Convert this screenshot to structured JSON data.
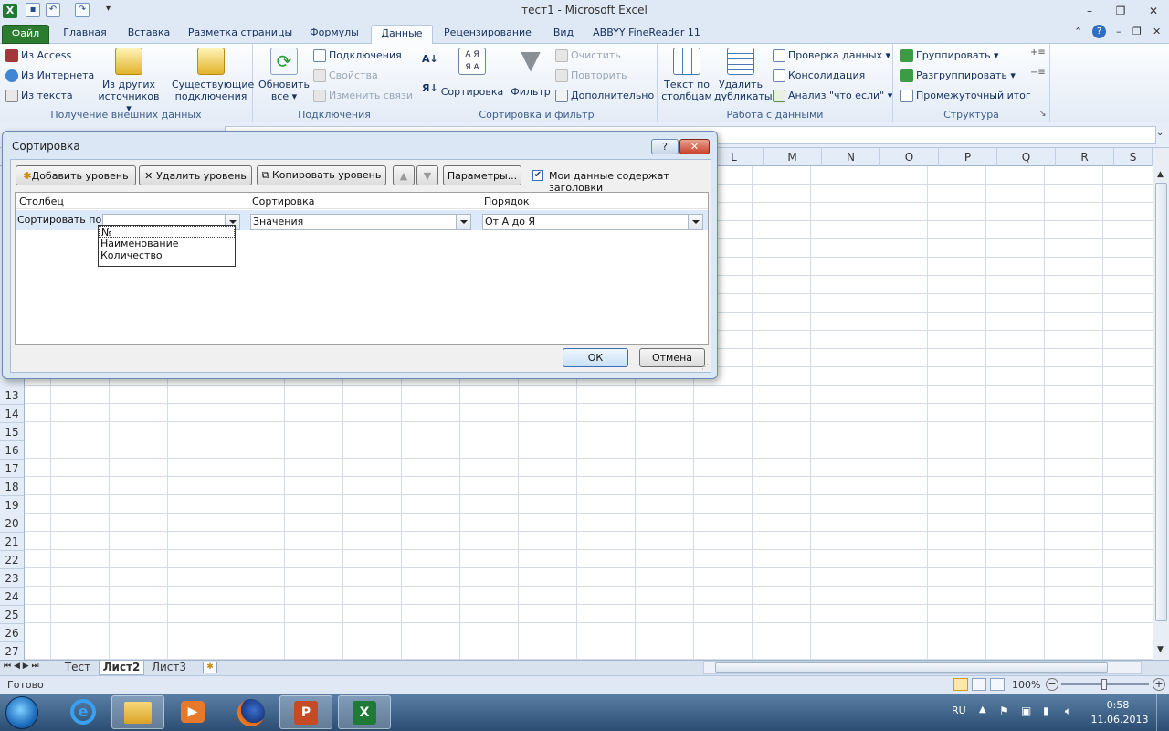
{
  "window": {
    "title": "тест1  -  Microsoft Excel"
  },
  "tabs": [
    "Файл",
    "Главная",
    "Вставка",
    "Разметка страницы",
    "Формулы",
    "Данные",
    "Рецензирование",
    "Вид",
    "ABBYY FineReader 11"
  ],
  "ribbon": {
    "external": {
      "access": "Из Access",
      "web": "Из Интернета",
      "text": "Из текста",
      "other1": "Из других",
      "other2": "источников",
      "exist1": "Существующие",
      "exist2": "подключения",
      "label": "Получение внешних данных"
    },
    "connections": {
      "refresh1": "Обновить",
      "refresh2": "все",
      "conn": "Подключения",
      "props": "Свойства",
      "links": "Изменить связи",
      "label": "Подключения"
    },
    "sortfilter": {
      "sort": "Сортировка",
      "filter": "Фильтр",
      "clear": "Очистить",
      "reapply": "Повторить",
      "advanced": "Дополнительно",
      "label": "Сортировка и фильтр"
    },
    "datatools": {
      "t2c1": "Текст по",
      "t2c2": "столбцам",
      "dup1": "Удалить",
      "dup2": "дубликаты",
      "validation": "Проверка данных",
      "consolidate": "Консолидация",
      "whatif": "Анализ \"что если\"",
      "label": "Работа с данными"
    },
    "outline": {
      "group": "Группировать",
      "ungroup": "Разгруппировать",
      "subtotal": "Промежуточный итог",
      "label": "Структура"
    }
  },
  "columns": [
    "L",
    "M",
    "N",
    "O",
    "P",
    "Q",
    "R",
    "S"
  ],
  "rows": [
    "13",
    "14",
    "15",
    "16",
    "17",
    "18",
    "19",
    "20",
    "21",
    "22",
    "23",
    "24",
    "25",
    "26",
    "27"
  ],
  "sheets": [
    "Тест",
    "Лист2",
    "Лист3"
  ],
  "status": {
    "ready": "Готово",
    "zoom": "100%"
  },
  "tray": {
    "lang": "RU",
    "time": "0:58",
    "date": "11.06.2013"
  },
  "dialog": {
    "title": "Сортировка",
    "add": "Добавить уровень",
    "delete": "Удалить уровень",
    "copy": "Копировать уровень",
    "options": "Параметры...",
    "headers": "Мои данные содержат заголовки",
    "col_header": "Столбец",
    "sort_header": "Сортировка",
    "order_header": "Порядок",
    "sort_by": "Сортировать по",
    "sort_on": "Значения",
    "order": "От А до Я",
    "options_list": [
      "№",
      "Наименование",
      "Количество"
    ],
    "ok": "ОК",
    "cancel": "Отмена"
  }
}
